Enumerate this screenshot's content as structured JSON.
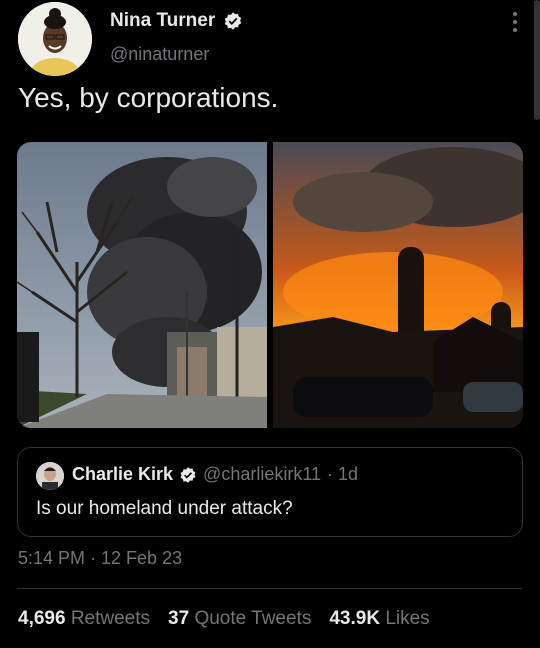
{
  "author": {
    "name": "Nina Turner",
    "handle": "@ninaturner"
  },
  "tweet": {
    "text": "Yes, by corporations."
  },
  "media": {
    "left_image": "Dark smoke cloud over residential street",
    "right_image": "Orange fire glow with silos"
  },
  "quote": {
    "name": "Charlie Kirk",
    "handle": "@charliekirk11",
    "time": "· 1d",
    "text": "Is our homeland under attack?"
  },
  "timestamp": "5:14 PM · 12 Feb 23",
  "stats": [
    {
      "count": "4,696",
      "label": "Retweets"
    },
    {
      "count": "37",
      "label": "Quote Tweets"
    },
    {
      "count": "43.9K",
      "label": "Likes"
    }
  ],
  "colors": {
    "background": "#000000",
    "text": "#e7e9ea",
    "muted": "#71767b",
    "verified": "#e7e9ea",
    "border": "#2f3336"
  }
}
